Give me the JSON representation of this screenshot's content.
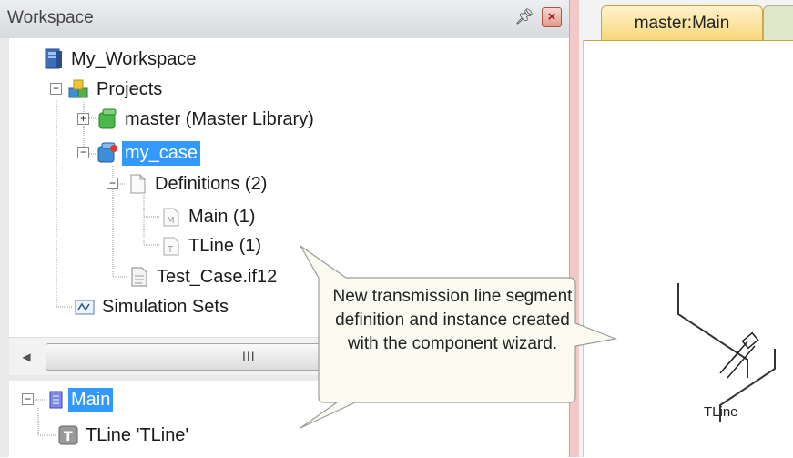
{
  "workspace": {
    "title": "Workspace",
    "pin_icon": "pin-icon",
    "close_icon": "close-icon",
    "close_glyph": "×",
    "tree": [
      {
        "label": "My_Workspace",
        "icon": "workspace-icon"
      },
      {
        "label": "Projects",
        "icon": "projects-icon"
      },
      {
        "label": "master (Master Library)",
        "icon": "library-icon"
      },
      {
        "label": "my_case",
        "icon": "case-icon",
        "selected": true
      },
      {
        "label": "Definitions (2)",
        "icon": "definitions-icon"
      },
      {
        "label": "Main (1)",
        "icon": "main-definition-icon"
      },
      {
        "label": "TLine (1)",
        "icon": "tline-definition-icon"
      },
      {
        "label": "Test_Case.if12",
        "icon": "file-icon"
      },
      {
        "label": "Simulation Sets",
        "icon": "simulation-sets-icon"
      }
    ],
    "scrollbar": {
      "grip": "III",
      "left_arrow": "◀"
    },
    "bottom_tree": [
      {
        "label": "Main",
        "icon": "page-icon",
        "selected": true
      },
      {
        "label": "TLine 'TLine'",
        "icon": "tline-component-icon"
      }
    ]
  },
  "document": {
    "tab_label": "master:Main",
    "canvas_label": "TLine"
  },
  "callout": {
    "text": "New transmission line segment definition and instance created with the component wizard."
  },
  "colors": {
    "selection": "#3399ff",
    "tab_active": "#f7d77a",
    "callout_bg": "#fbfbf1"
  }
}
